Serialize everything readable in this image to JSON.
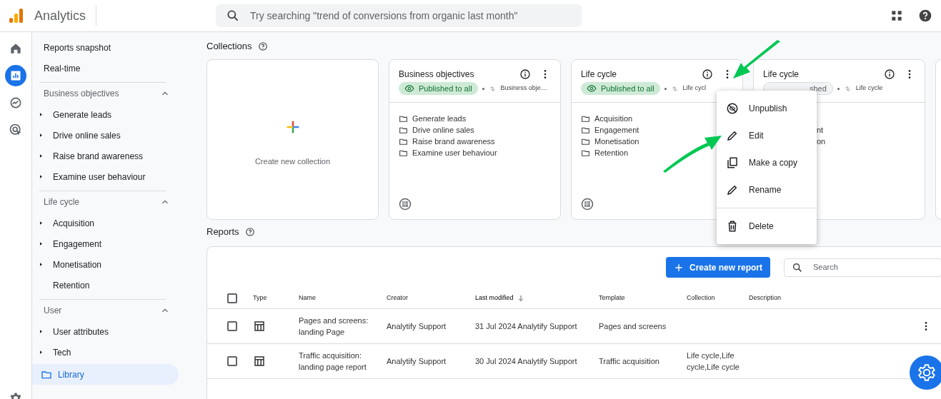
{
  "app": {
    "title": "Analytics"
  },
  "search": {
    "placeholder": "Try searching \"trend of conversions from organic last month\""
  },
  "nav_rail": [
    {
      "kind": "home",
      "selected": false
    },
    {
      "kind": "reports",
      "selected": true
    },
    {
      "kind": "explore",
      "selected": false
    },
    {
      "kind": "advertising",
      "selected": false
    }
  ],
  "sidebar": {
    "top_items": [
      "Reports snapshot",
      "Real-time"
    ],
    "sections": [
      {
        "title": "Business objectives",
        "expanded": true,
        "items": [
          {
            "label": "Generate leads",
            "expandable": true
          },
          {
            "label": "Drive online sales",
            "expandable": true
          },
          {
            "label": "Raise brand awareness",
            "expandable": true
          },
          {
            "label": "Examine user behaviour",
            "expandable": true
          }
        ]
      },
      {
        "title": "Life cycle",
        "expanded": true,
        "items": [
          {
            "label": "Acquisition",
            "expandable": true
          },
          {
            "label": "Engagement",
            "expandable": true
          },
          {
            "label": "Monetisation",
            "expandable": true
          },
          {
            "label": "Retention",
            "expandable": false
          }
        ]
      },
      {
        "title": "User",
        "expanded": true,
        "items": [
          {
            "label": "User attributes",
            "expandable": true
          },
          {
            "label": "Tech",
            "expandable": true
          }
        ]
      }
    ],
    "library": {
      "label": "Library",
      "selected": true
    }
  },
  "collections": {
    "heading": "Collections",
    "cards": [
      {
        "kind": "create",
        "label": "Create new collection"
      },
      {
        "kind": "collection",
        "title": "Business objectives",
        "badge": {
          "label": "Published to all",
          "published": true
        },
        "link": "Business obje…",
        "items": [
          "Generate leads",
          "Drive online sales",
          "Raise brand awareness",
          "Examine user behaviour"
        ],
        "covered": false
      },
      {
        "kind": "collection",
        "title": "Life cycle",
        "badge": {
          "label": "Published to all",
          "published": true
        },
        "link": "Life cycl",
        "items": [
          "Acquisition",
          "Engagement",
          "Monetisation",
          "Retention"
        ],
        "covered": false
      },
      {
        "kind": "collection",
        "title": "Life cycle",
        "badge": {
          "label": "shed",
          "published": false
        },
        "link": "Life cycle",
        "items": [
          "nt",
          "on"
        ],
        "covered": true
      }
    ]
  },
  "menu": [
    {
      "kind": "unpublish",
      "label": "Unpublish"
    },
    {
      "kind": "edit",
      "label": "Edit"
    },
    {
      "kind": "copy",
      "label": "Make a copy"
    },
    {
      "kind": "rename",
      "label": "Rename"
    },
    {
      "kind": "delete",
      "label": "Delete",
      "divider_before": true
    }
  ],
  "reports": {
    "heading": "Reports",
    "select_all_checked": false,
    "create_button": "Create new report",
    "search_placeholder": "Search",
    "columns": [
      {
        "label": "Type",
        "sorted": false
      },
      {
        "label": "Name",
        "sorted": false
      },
      {
        "label": "Creator",
        "sorted": false
      },
      {
        "label": "Last modified",
        "sorted": true
      },
      {
        "label": "Template",
        "sorted": false
      },
      {
        "label": "Collection",
        "sorted": false
      },
      {
        "label": "Description",
        "sorted": false
      }
    ],
    "rows": [
      {
        "checked": false,
        "name": "Pages and screens: landing Page",
        "creator": "Analytify Support",
        "last_modified": "31 Jul 2024 Analytify Support",
        "template": "Pages and screens"
      },
      {
        "checked": false,
        "name": "Traffic acquisition: landing page report",
        "creator": "Analytify Support",
        "last_modified": "30 Jul 2024 Analytify Support",
        "template": "Traffic acquisition",
        "collection": "Life cycle,Life cycle,Life cycle"
      }
    ]
  }
}
